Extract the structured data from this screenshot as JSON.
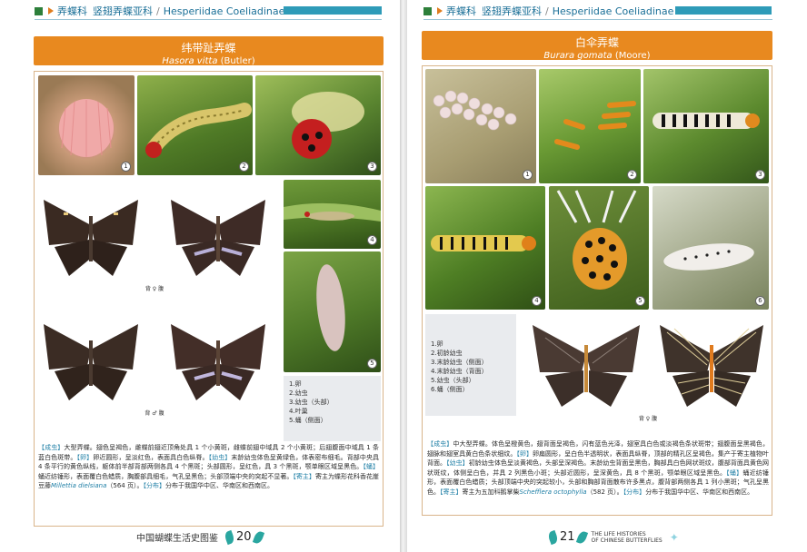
{
  "left_page": {
    "header": {
      "family": "弄蝶科",
      "subfamily": "竖翅弄蝶亚科",
      "latin": "Hesperiidae Coeliadinae"
    },
    "title": {
      "zh": "纬带趾弄蝶",
      "latin_genus_species": "Hasora vitta",
      "author": "(Butler)"
    },
    "photo_numbers": [
      "1",
      "2",
      "3",
      "4",
      "5"
    ],
    "caption_top": "背  ♀  腹",
    "caption_bottom": "背  ♂  腹",
    "key": [
      "1.卵",
      "2.幼虫",
      "3.幼虫（头部）",
      "4.叶巢",
      "5.蛹（侧面）"
    ],
    "description": {
      "adult_tag": "【成虫】",
      "adult": "大型弄蝶。翅色呈褐色，雌蝶前翅近顶角处具 1 个小黄斑，雌蝶前翅中域具 2 个小黄斑；后翅腹面中域具 1 条蓝白色斑带。",
      "egg_tag": "【卵】",
      "egg": "卵近圆形，呈淡红色，表面具白色纵脊。",
      "larva_tag": "【幼虫】",
      "larva": "末龄幼虫体色呈黄绿色，体表密布细毛。背部中央具 4 条平行的黄色纵线，躯体前半部背部两侧各具 4 个黑斑；头部圆形，呈红色，具 3 个黑斑，颚单眼区域呈黑色。",
      "pupa_tag": "【蛹】",
      "pupa": "蛹近纺锤形，表面覆白色蜡质，胸腹部具细毛，气孔呈黑色；头部顶端中央的突起不显著。",
      "host_tag": "【寄主】",
      "host": "寄主为蝶形花科香花崖豆藤",
      "host_species": "Millettia dielsiana",
      "host_count": "（564 页）。",
      "dist_tag": "【分布】",
      "dist": "分布于我国华中区、华南区和西南区。"
    },
    "footer": {
      "book": "中国蝴蝶生活史图鉴",
      "page": "20"
    }
  },
  "right_page": {
    "header": {
      "family": "弄蝶科",
      "subfamily": "竖翅弄蝶亚科",
      "latin": "Hesperiidae Coeliadinae"
    },
    "title": {
      "zh": "白伞弄蝶",
      "latin_genus_species": "Burara gomata",
      "author": "(Moore)"
    },
    "photo_numbers": [
      "1",
      "2",
      "3",
      "4",
      "5",
      "6"
    ],
    "caption": "背  ♀  腹",
    "key": [
      "1.卵",
      "2.初龄幼虫",
      "3.末龄幼虫（侧面）",
      "4.末龄幼虫（背面）",
      "5.幼虫（头部）",
      "6.蛹（侧面）"
    ],
    "description": {
      "adult_tag": "【成虫】",
      "adult": "中大型弄蝶。体色呈橙黄色，翅背面呈褐色，闪有蓝色光泽，翅室具白色或淡褐色条状斑带；翅腹面呈黑褐色，翅脉和翅室具黄白色条状细纹。",
      "egg_tag": "【卵】",
      "egg": "卵扁圆形，呈白色半透明状，表面具纵脊，顶部的精孔区呈褐色，集产于寄主植物叶背面。",
      "larva_tag": "【幼虫】",
      "larva": "初龄幼虫体色呈淡黄褐色，头部呈深褐色。末龄幼虫背面呈黑色，胸部具白色网状斑纹，腹部背面具黄色网状斑纹，体侧呈白色，并具 2 列黑色小斑；头部近圆形，呈深黄色，具 8 个黑斑，颚单眼区域呈黑色。",
      "pupa_tag": "【蛹】",
      "pupa": "蛹近纺锤形，表面覆白色蜡质；头部顶端中央的突起较小，头部和胸部背面散布许多黑点，腹背部两侧各具 1 列小黑斑；气孔呈黑色。",
      "host_tag": "【寄主】",
      "host": "寄主为五加科鹅掌柴",
      "host_species": "Schefflera octophylla",
      "host_count": "（582 页）。",
      "dist_tag": "【分布】",
      "dist": "分布于我国华中区、华南区和西南区。"
    },
    "footer": {
      "page": "21",
      "en_line1": "THE LIFE HISTORIES",
      "en_line2": "OF CHINESE BUTTERFLIES"
    }
  }
}
